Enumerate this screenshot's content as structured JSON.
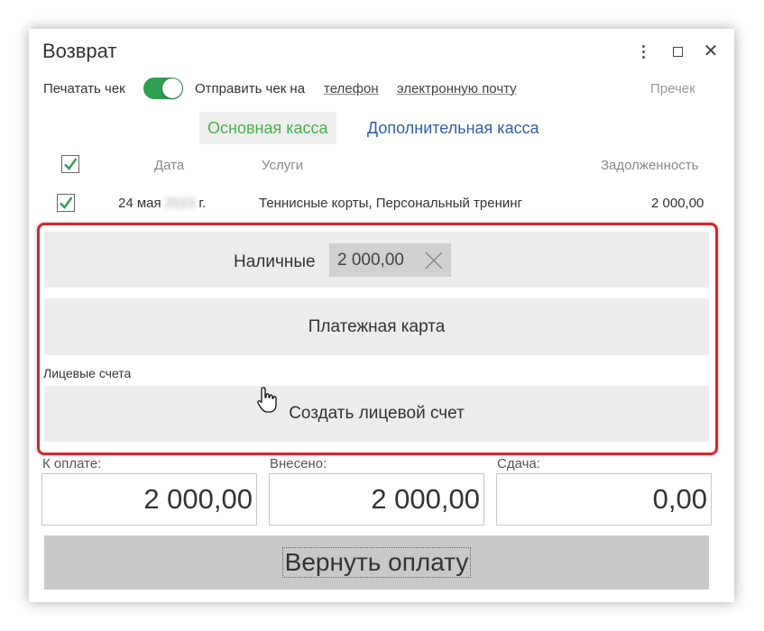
{
  "window": {
    "title": "Возврат"
  },
  "options": {
    "print_receipt_label": "Печатать чек",
    "print_receipt_on": true,
    "send_receipt_label": "Отправить чек на",
    "phone_link": "телефон",
    "email_link": "электронную почту",
    "precheck_label": "Пречек"
  },
  "tabs": [
    {
      "label": "Основная касса",
      "active": true
    },
    {
      "label": "Дополнительная касса",
      "active": false
    }
  ],
  "table": {
    "headers": {
      "date": "Дата",
      "services": "Услуги",
      "debt": "Задолженность"
    },
    "rows": [
      {
        "checked": true,
        "date_prefix": "24 мая",
        "date_year": "2023",
        "date_suffix": "г.",
        "services": "Теннисные корты, Персональный тренинг",
        "debt": "2 000,00"
      }
    ]
  },
  "payment": {
    "cash_label": "Наличные",
    "cash_value": "2 000,00",
    "card_label": "Платежная карта",
    "accounts_label": "Лицевые счета",
    "create_account_label": "Создать лицевой счет"
  },
  "totals": {
    "to_pay_label": "К оплате:",
    "to_pay_value": "2 000,00",
    "paid_label": "Внесено:",
    "paid_value": "2 000,00",
    "change_label": "Сдача:",
    "change_value": "0,00"
  },
  "actions": {
    "return_label": "Вернуть оплату"
  },
  "colors": {
    "accent_green": "#2e9e4f",
    "tab_active": "#4caf50",
    "tab_link": "#2f5ea8",
    "highlight_red": "#d6262e"
  },
  "icons": [
    "kebab-icon",
    "maximize-icon",
    "close-icon",
    "checkmark-icon",
    "clear-icon",
    "hand-pointer-icon"
  ]
}
